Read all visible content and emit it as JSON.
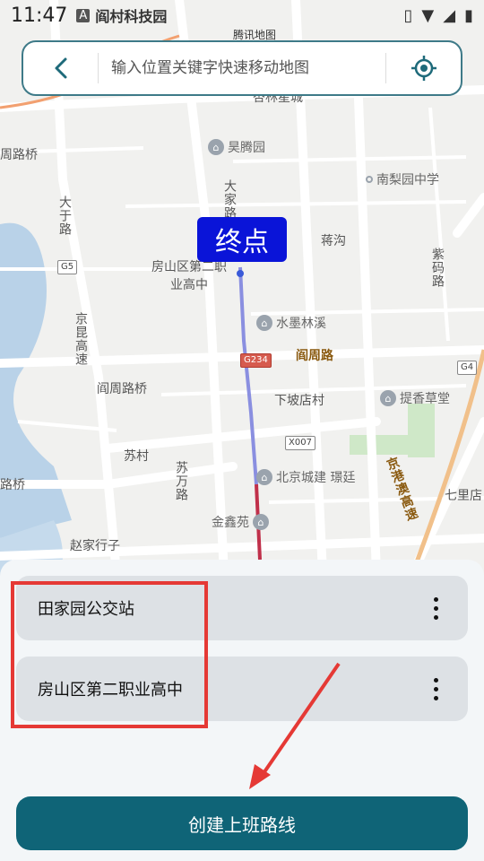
{
  "status_bar": {
    "time": "11:47",
    "app_title": "阎村科技园"
  },
  "search": {
    "placeholder": "输入位置关键字快速移动地图"
  },
  "map": {
    "attribution": "腾讯地图",
    "end_label": "终点",
    "labels": {
      "xingxing": "杏林星城",
      "haoteng": "昊腾园",
      "nanliyuan": "南梨园中学",
      "tianqiao_road": "周路桥",
      "dataishou_road": "大于路",
      "dajiao_road": "大家路",
      "jianggou": "蒋沟",
      "fangshan_school": "房山区第二职业高中",
      "zimalu": "紫码路",
      "shuimolinxi": "水墨林溪",
      "yanzhoulu": "阎周路",
      "jingkunhighway": "京昆高速",
      "yanzhouluqiao": "阎周路桥",
      "xiapodian": "下坡店村",
      "tixiangcaotang": "提香草堂",
      "sucun": "苏村",
      "suwanlu": "苏万路",
      "beijingchengjian": "北京城建 璟廷",
      "jgaa_highway": "京港澳高速",
      "qilidian": "七里店",
      "lubridge": "路桥",
      "jinxinyuan": "金鑫苑",
      "zhaojiahangzi": "赵家行子",
      "g5": "G5",
      "g234": "G234",
      "g4": "G4",
      "x007": "X007"
    }
  },
  "stops": [
    {
      "name": "田家园公交站"
    },
    {
      "name": "房山区第二职业高中"
    }
  ],
  "actions": {
    "create_route": "创建上班路线"
  },
  "colors": {
    "accent": "#0f6477",
    "end_label_bg": "#0a14d8",
    "route": "#8a8fe0",
    "highlight": "#e53935"
  }
}
